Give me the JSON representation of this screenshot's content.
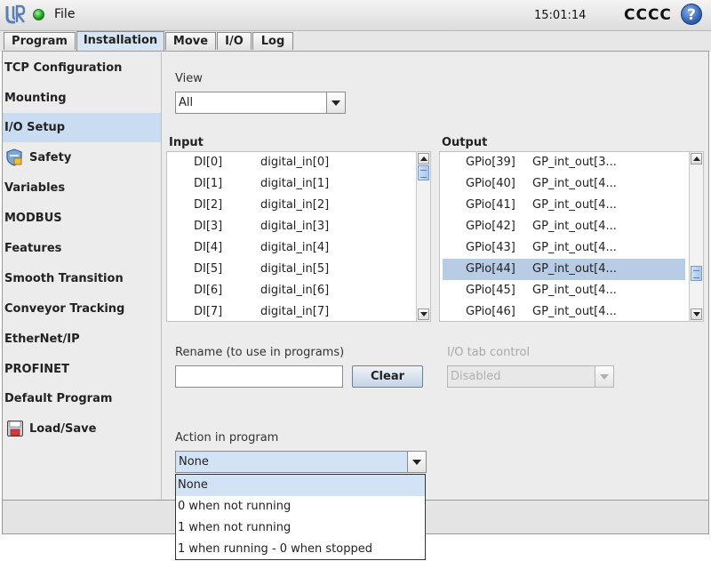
{
  "header": {
    "file_menu": "File",
    "clock": "15:01:14",
    "robot_name": "CCCC",
    "help_symbol": "?",
    "status_color": "#1d9b1d"
  },
  "tabs": [
    {
      "label": "Program",
      "active": false
    },
    {
      "label": "Installation",
      "active": true
    },
    {
      "label": "Move",
      "active": false
    },
    {
      "label": "I/O",
      "active": false
    },
    {
      "label": "Log",
      "active": false
    }
  ],
  "sidebar": {
    "items": [
      {
        "label": "TCP Configuration"
      },
      {
        "label": "Mounting"
      },
      {
        "label": "I/O Setup",
        "selected": true
      },
      {
        "label": "Safety",
        "icon": "shield-icon"
      },
      {
        "label": "Variables"
      },
      {
        "label": "MODBUS"
      },
      {
        "label": "Features"
      },
      {
        "label": "Smooth Transition"
      },
      {
        "label": "Conveyor Tracking"
      },
      {
        "label": "EtherNet/IP"
      },
      {
        "label": "PROFINET"
      },
      {
        "label": "Default Program"
      },
      {
        "label": "Load/Save",
        "icon": "floppy-disk-icon"
      }
    ]
  },
  "view": {
    "label": "View",
    "value": "All"
  },
  "input": {
    "header": "Input",
    "rows": [
      {
        "id": "DI[0]",
        "name": "digital_in[0]"
      },
      {
        "id": "DI[1]",
        "name": "digital_in[1]"
      },
      {
        "id": "DI[2]",
        "name": "digital_in[2]"
      },
      {
        "id": "DI[3]",
        "name": "digital_in[3]"
      },
      {
        "id": "DI[4]",
        "name": "digital_in[4]"
      },
      {
        "id": "DI[5]",
        "name": "digital_in[5]"
      },
      {
        "id": "DI[6]",
        "name": "digital_in[6]"
      },
      {
        "id": "DI[7]",
        "name": "digital_in[7]"
      }
    ]
  },
  "output": {
    "header": "Output",
    "rows": [
      {
        "id": "GPio[39]",
        "name": "GP_int_out[3..."
      },
      {
        "id": "GPio[40]",
        "name": "GP_int_out[4..."
      },
      {
        "id": "GPio[41]",
        "name": "GP_int_out[4..."
      },
      {
        "id": "GPio[42]",
        "name": "GP_int_out[4..."
      },
      {
        "id": "GPio[43]",
        "name": "GP_int_out[4..."
      },
      {
        "id": "GPio[44]",
        "name": "GP_int_out[4...",
        "selected": true
      },
      {
        "id": "GPio[45]",
        "name": "GP_int_out[4..."
      },
      {
        "id": "GPio[46]",
        "name": "GP_int_out[4..."
      }
    ]
  },
  "rename": {
    "label": "Rename (to use in programs)",
    "value": "",
    "clear_label": "Clear"
  },
  "io_tab_control": {
    "label": "I/O tab control",
    "value": "Disabled"
  },
  "action": {
    "label": "Action in program",
    "value": "None",
    "options": [
      {
        "label": "None",
        "selected": true
      },
      {
        "label": "0 when not running"
      },
      {
        "label": "1 when not running"
      },
      {
        "label": "1 when running - 0 when stopped"
      }
    ]
  }
}
